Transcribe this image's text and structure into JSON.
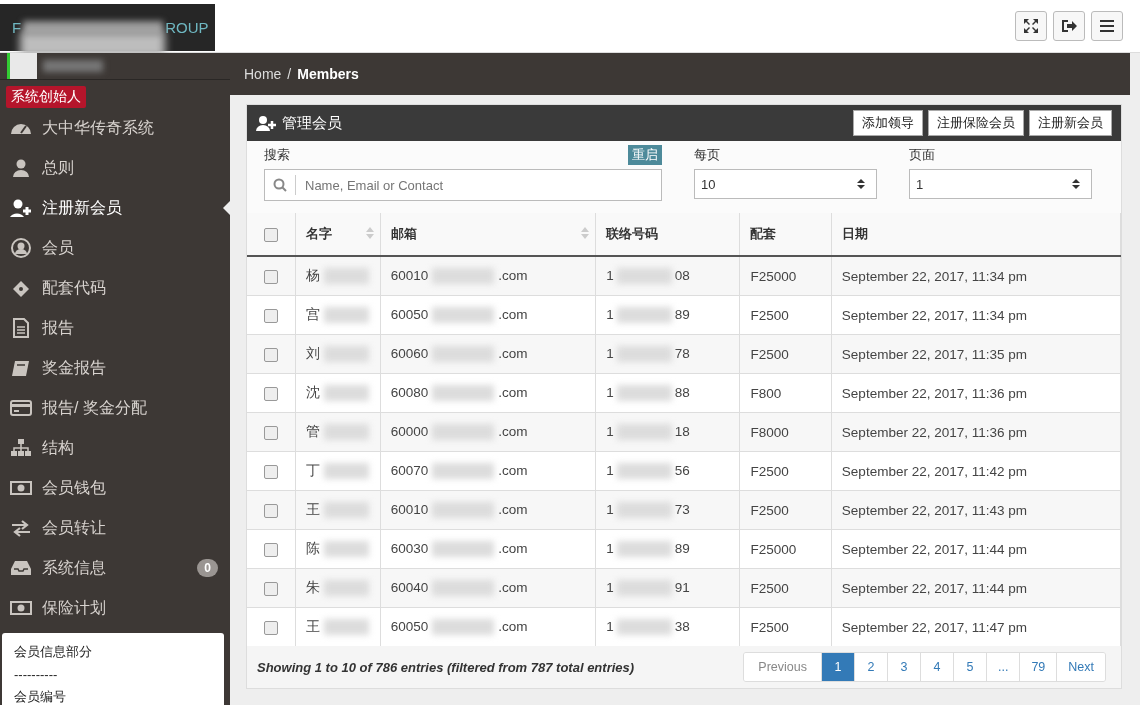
{
  "header": {
    "logo": {
      "start": "F",
      "end": "ROUP"
    }
  },
  "sidebar": {
    "role_badge": "系统创始人",
    "items": [
      {
        "label": "大中华传奇系统",
        "selected": false
      },
      {
        "label": "总则",
        "selected": false
      },
      {
        "label": "注册新会员",
        "selected": true
      },
      {
        "label": "会员",
        "selected": false
      },
      {
        "label": "配套代码",
        "selected": false
      },
      {
        "label": "报告",
        "selected": false
      },
      {
        "label": "奖金报告",
        "selected": false
      },
      {
        "label": "报告/ 奖金分配",
        "selected": false
      },
      {
        "label": "结构",
        "selected": false
      },
      {
        "label": "会员钱包",
        "selected": false
      },
      {
        "label": "会员转让",
        "selected": false
      },
      {
        "label": "系统信息",
        "selected": false,
        "count": "0"
      },
      {
        "label": "保险计划",
        "selected": false
      }
    ],
    "info_box": [
      "会员信息部分",
      "----------",
      "会员编号"
    ]
  },
  "breadcrumb": [
    {
      "label": "Home",
      "current": false,
      "separator": "/"
    },
    {
      "label": "Members",
      "current": true
    }
  ],
  "panel": {
    "title": "管理会员",
    "actions": [
      "添加领导",
      "注册保险会员",
      "注册新会员"
    ],
    "filters": {
      "search_label": "搜索",
      "reset": "重启",
      "search_placeholder": "Name, Email or Contact",
      "per_page_label": "每页",
      "per_page": "10",
      "page_label": "页面",
      "page": "1"
    },
    "table": {
      "select_all_checked": false,
      "columns": [
        {
          "label": "名字",
          "sortable": true
        },
        {
          "label": "邮箱",
          "sortable": true
        },
        {
          "label": "联络号码",
          "sortable": false
        },
        {
          "label": "配套",
          "sortable": false
        },
        {
          "label": "日期",
          "sortable": false
        }
      ],
      "rows": [
        {
          "checked": false,
          "name": "杨",
          "email_start": "60010",
          "email_end": ".com",
          "phone_start": "1",
          "phone_end": "08",
          "package": "F25000",
          "date": "September 22, 2017, 11:34 pm"
        },
        {
          "checked": false,
          "name": "宫",
          "email_start": "60050",
          "email_end": ".com",
          "phone_start": "1",
          "phone_end": "89",
          "package": "F2500",
          "date": "September 22, 2017, 11:34 pm"
        },
        {
          "checked": false,
          "name": "刘",
          "email_start": "60060",
          "email_end": ".com",
          "phone_start": "1",
          "phone_end": "78",
          "package": "F2500",
          "date": "September 22, 2017, 11:35 pm"
        },
        {
          "checked": false,
          "name": "沈",
          "email_start": "60080",
          "email_end": ".com",
          "phone_start": "1",
          "phone_end": "88",
          "package": "F800",
          "date": "September 22, 2017, 11:36 pm"
        },
        {
          "checked": false,
          "name": "管",
          "email_start": "60000",
          "email_end": ".com",
          "phone_start": "1",
          "phone_end": "18",
          "package": "F8000",
          "date": "September 22, 2017, 11:36 pm"
        },
        {
          "checked": false,
          "name": "丁",
          "email_start": "60070",
          "email_end": ".com",
          "phone_start": "1",
          "phone_end": "56",
          "package": "F2500",
          "date": "September 22, 2017, 11:42 pm"
        },
        {
          "checked": false,
          "name": "王",
          "email_start": "60010",
          "email_end": ".com",
          "phone_start": "1",
          "phone_end": "73",
          "package": "F2500",
          "date": "September 22, 2017, 11:43 pm"
        },
        {
          "checked": false,
          "name": "陈",
          "email_start": "60030",
          "email_end": ".com",
          "phone_start": "1",
          "phone_end": "89",
          "package": "F25000",
          "date": "September 22, 2017, 11:44 pm"
        },
        {
          "checked": false,
          "name": "朱",
          "email_start": "60040",
          "email_end": ".com",
          "phone_start": "1",
          "phone_end": "91",
          "package": "F2500",
          "date": "September 22, 2017, 11:44 pm"
        },
        {
          "checked": false,
          "name": "王",
          "email_start": "60050",
          "email_end": ".com",
          "phone_start": "1",
          "phone_end": "38",
          "package": "F2500",
          "date": "September 22, 2017, 11:47 pm"
        }
      ]
    },
    "footer": {
      "summary": "Showing 1 to 10 of 786 entries (filtered from 787 total entries)",
      "pagination": [
        {
          "label": "Previous",
          "selected": false,
          "disabled": true
        },
        {
          "label": "1",
          "selected": true,
          "disabled": false
        },
        {
          "label": "2",
          "selected": false,
          "disabled": false
        },
        {
          "label": "3",
          "selected": false,
          "disabled": false
        },
        {
          "label": "4",
          "selected": false,
          "disabled": false
        },
        {
          "label": "5",
          "selected": false,
          "disabled": false
        },
        {
          "label": "...",
          "selected": false,
          "disabled": false
        },
        {
          "label": "79",
          "selected": false,
          "disabled": false
        },
        {
          "label": "Next",
          "selected": false,
          "disabled": false
        }
      ]
    }
  }
}
